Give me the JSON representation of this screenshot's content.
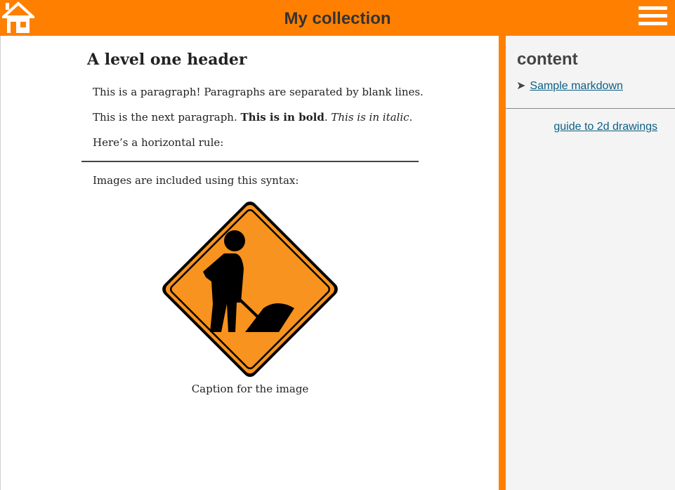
{
  "header": {
    "title": "My collection",
    "home_icon": "home-icon",
    "menu_icon": "hamburger-menu-icon",
    "bg_color": "#ff8000"
  },
  "article": {
    "heading": "A level one header",
    "p1": "This is a paragraph! Paragraphs are separated by blank lines.",
    "p2_text": "This is the next paragraph. ",
    "p2_bold": "This is in bold",
    "p2_mid": ". ",
    "p2_italic": "This is in italic",
    "p2_end": ".",
    "p3": "Here’s a horizontal rule:",
    "p4": "Images are included using this syntax:",
    "image_icon": "road-work-sign-icon",
    "caption": "Caption for the image"
  },
  "sidebar": {
    "title": "content",
    "toc_items": [
      {
        "label": "Sample markdown"
      }
    ],
    "guide_link": "guide to 2d drawings",
    "link_color": "#0a5f86"
  }
}
